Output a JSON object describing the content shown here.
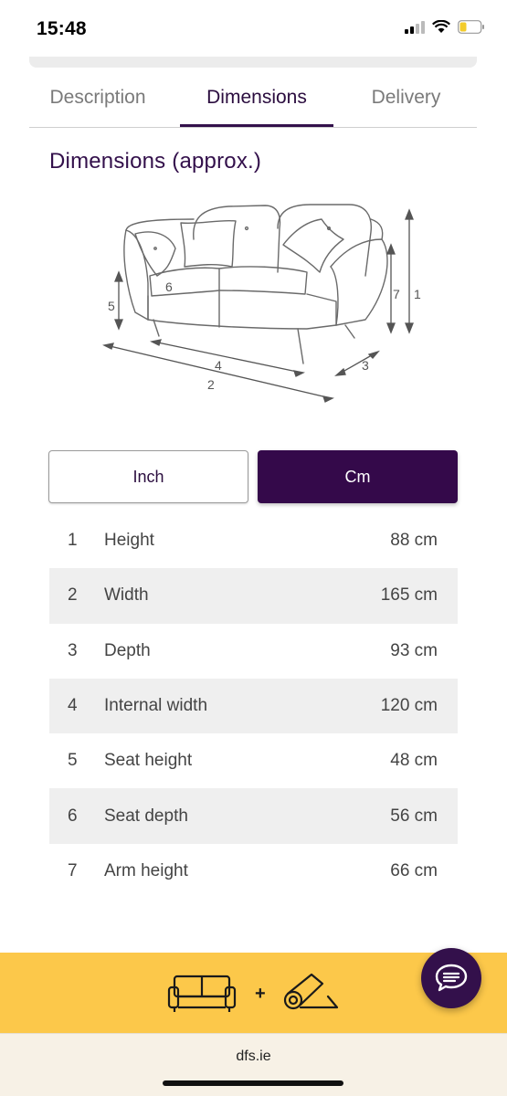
{
  "status_bar": {
    "time": "15:48"
  },
  "tabs": [
    {
      "label": "Description",
      "active": false
    },
    {
      "label": "Dimensions",
      "active": true
    },
    {
      "label": "Delivery",
      "active": false
    }
  ],
  "section": {
    "title": "Dimensions (approx.)"
  },
  "diagram": {
    "labels": [
      "1",
      "2",
      "3",
      "4",
      "5",
      "6",
      "7"
    ]
  },
  "units": {
    "inch_label": "Inch",
    "cm_label": "Cm",
    "selected": "Cm"
  },
  "dimensions": [
    {
      "num": "1",
      "label": "Height",
      "value": "88 cm"
    },
    {
      "num": "2",
      "label": "Width",
      "value": "165 cm"
    },
    {
      "num": "3",
      "label": "Depth",
      "value": "93 cm"
    },
    {
      "num": "4",
      "label": "Internal width",
      "value": "120 cm"
    },
    {
      "num": "5",
      "label": "Seat height",
      "value": "48 cm"
    },
    {
      "num": "6",
      "label": "Seat depth",
      "value": "56 cm"
    },
    {
      "num": "7",
      "label": "Arm height",
      "value": "66 cm"
    }
  ],
  "promo": {
    "plus": "+",
    "icons": [
      "sofa-icon",
      "rug-icon"
    ]
  },
  "chat": {
    "icon": "chat-bubble-icon"
  },
  "browser": {
    "url": "dfs.ie"
  },
  "colors": {
    "brand_purple": "#33104b",
    "promo_yellow": "#fcc84a",
    "row_alt": "#efefef"
  }
}
